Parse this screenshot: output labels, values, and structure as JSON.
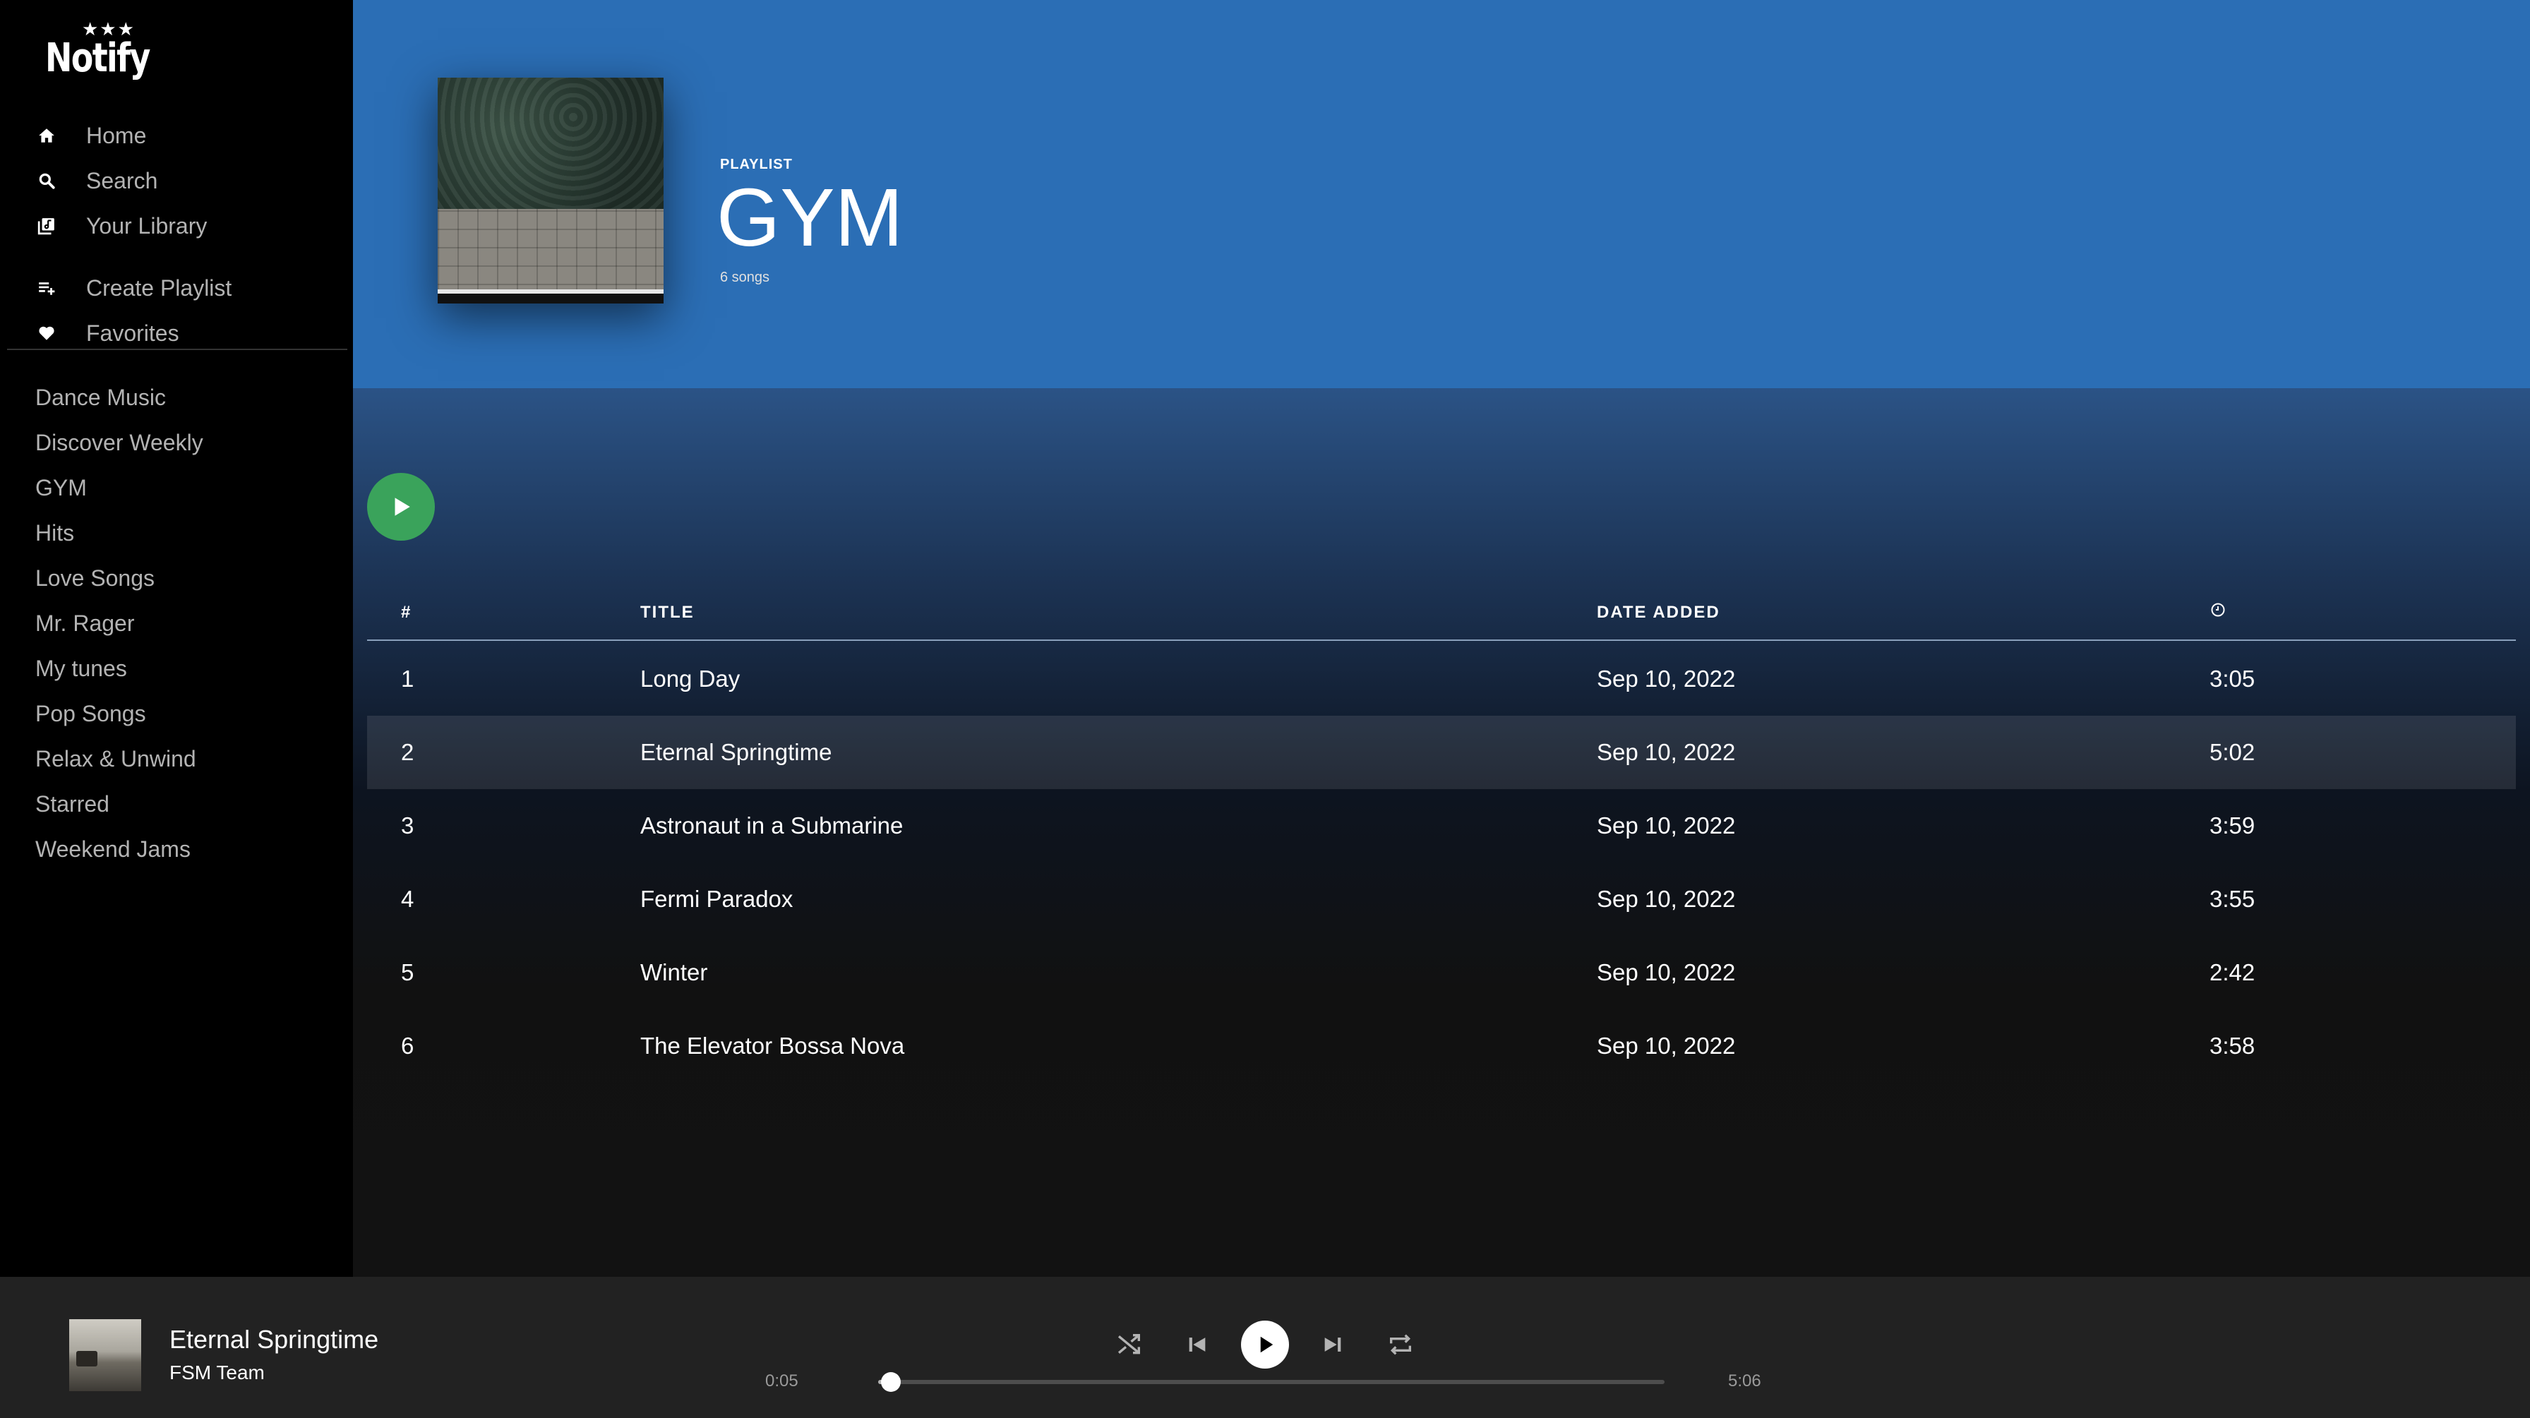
{
  "app": {
    "logo_text": "Notify",
    "logo_stars": "★★★"
  },
  "sidebar": {
    "nav": [
      {
        "label": "Home",
        "icon": "home-icon"
      },
      {
        "label": "Search",
        "icon": "search-icon"
      },
      {
        "label": "Your Library",
        "icon": "library-icon"
      },
      {
        "label": "Create Playlist",
        "icon": "add-playlist-icon"
      },
      {
        "label": "Favorites",
        "icon": "heart-icon"
      }
    ],
    "playlists": [
      "Dance Music",
      "Discover Weekly",
      "GYM",
      "Hits",
      "Love Songs",
      "Mr. Rager",
      "My tunes",
      "Pop Songs",
      "Relax & Unwind",
      "Starred",
      "Weekend Jams"
    ]
  },
  "playlist": {
    "kind": "PLAYLIST",
    "title": "GYM",
    "count": "6 songs",
    "header_color": "#2b6eb5"
  },
  "table": {
    "headers": {
      "num": "#",
      "title": "TITLE",
      "date": "DATE ADDED",
      "duration_icon": "clock-icon"
    },
    "rows": [
      {
        "num": "1",
        "title": "Long Day",
        "date": "Sep 10, 2022",
        "duration": "3:05"
      },
      {
        "num": "2",
        "title": "Eternal Springtime",
        "date": "Sep 10, 2022",
        "duration": "5:02",
        "active": true
      },
      {
        "num": "3",
        "title": "Astronaut in a Submarine",
        "date": "Sep 10, 2022",
        "duration": "3:59"
      },
      {
        "num": "4",
        "title": "Fermi Paradox",
        "date": "Sep 10, 2022",
        "duration": "3:55"
      },
      {
        "num": "5",
        "title": "Winter",
        "date": "Sep 10, 2022",
        "duration": "2:42"
      },
      {
        "num": "6",
        "title": "The Elevator Bossa Nova",
        "date": "Sep 10, 2022",
        "duration": "3:58"
      }
    ]
  },
  "player": {
    "title": "Eternal Springtime",
    "artist": "FSM Team",
    "current_time": "0:05",
    "total_time": "5:06",
    "progress_fraction": 0.016,
    "accent": "#3aa35b"
  }
}
